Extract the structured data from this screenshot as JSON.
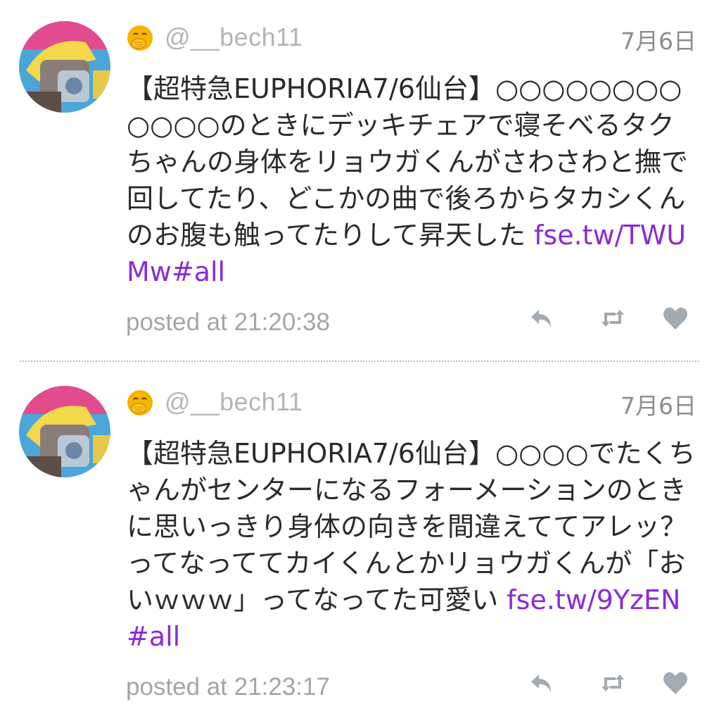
{
  "tweets": [
    {
      "handle": "@__bech11",
      "date": "7月6日",
      "text": "【超特急EUPHORIA7/6仙台】○○○○○○○○○○○○のときにデッキチェアで寝そべるタクちゃんの身体をリョウガくんがさわさわと撫で回してたり、どこかの曲で後ろからタカシくんのお腹も触ってたりして昇天した ",
      "link": "fse.tw/TWUMw#all",
      "posted": "posted at 21:20:38"
    },
    {
      "handle": "@__bech11",
      "date": "7月6日",
      "text": "【超特急EUPHORIA7/6仙台】○○○○でたくちゃんがセンターになるフォーメーションのときに思いっきり身体の向きを間違えててアレッ？ってなっててカイくんとかリョウガくんが「おいｗｗｗ」ってなってた可愛い ",
      "link": "fse.tw/9YzEN#all",
      "posted": "posted at 21:23:17"
    }
  ],
  "icons": {
    "status_emoji": "hand-over-mouth-emoji-icon",
    "reply": "reply-icon",
    "retweet": "retweet-icon",
    "like": "heart-icon"
  },
  "colors": {
    "link": "#8a2bd6",
    "handle": "#b4b4b4",
    "meta": "#a5a5a5",
    "action_icon": "#a3aab0",
    "emoji": "#f5b400"
  }
}
